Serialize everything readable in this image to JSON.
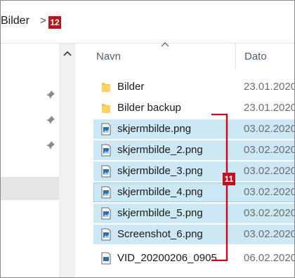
{
  "address": {
    "crumb": "Bilder",
    "separator": ">",
    "badge": "12"
  },
  "header": {
    "name_col": "Navn",
    "date_col": "Dato"
  },
  "files": [
    {
      "name": "Bilder",
      "date": "23.01.2020",
      "type": "folder",
      "selected": false
    },
    {
      "name": "Bilder backup",
      "date": "23.01.2020",
      "type": "folder",
      "selected": false
    },
    {
      "name": "skjermbilde.png",
      "date": "03.02.2020",
      "type": "image",
      "selected": true
    },
    {
      "name": "skjermbilde_2.png",
      "date": "03.02.2020",
      "type": "image",
      "selected": true
    },
    {
      "name": "skjermbilde_3.png",
      "date": "03.02.2020",
      "type": "image",
      "selected": true
    },
    {
      "name": "skjermbilde_4.png",
      "date": "03.02.2020",
      "type": "image",
      "selected": true
    },
    {
      "name": "skjermbilde_5.png",
      "date": "03.02.2020",
      "type": "image",
      "selected": true
    },
    {
      "name": "Screenshot_6.png",
      "date": "03.02.2020",
      "type": "image",
      "selected": true
    },
    {
      "name": "VID_20200206_0905...",
      "date": "06.02.2020",
      "type": "video",
      "selected": false
    }
  ],
  "annotation": {
    "badge": "11",
    "color": "#c0121c"
  },
  "colors": {
    "selection": "#cce8f4",
    "selection_border": "#99d1eb",
    "folder": "#f5c33b",
    "header_text": "#4c607a"
  }
}
